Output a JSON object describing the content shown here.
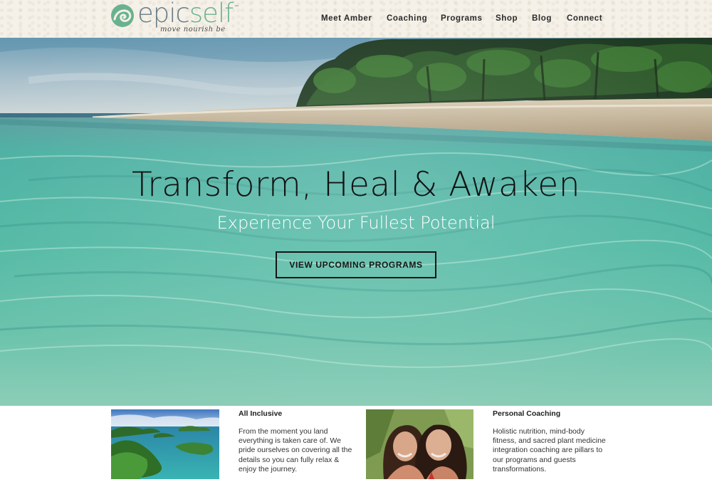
{
  "brand": {
    "logo_text_part1": "epic",
    "logo_text_part2": "self",
    "trademark": "™",
    "tagline": "move nourish be"
  },
  "nav": {
    "items": [
      {
        "label": "Meet Amber"
      },
      {
        "label": "Coaching"
      },
      {
        "label": "Programs"
      },
      {
        "label": "Shop"
      },
      {
        "label": "Blog"
      },
      {
        "label": "Connect"
      }
    ]
  },
  "hero": {
    "title": "Transform, Heal & Awaken",
    "subtitle": "Experience Your Fullest Potential",
    "cta_label": "VIEW UPCOMING PROGRAMS"
  },
  "features": [
    {
      "title": "All Inclusive",
      "text": "From the moment you land everything is taken care of. We pride ourselves on covering all the details so you can fully relax & enjoy the journey."
    },
    {
      "title": "Personal Coaching",
      "text": "Holistic nutrition, mind-body fitness, and sacred plant medicine integration coaching are pillars to our programs and guests transformations."
    }
  ],
  "colors": {
    "header_bg": "#f5f1e8",
    "logo_gray": "#6a7c86",
    "logo_green": "#6ab28f",
    "water_teal": "#4fb8a0",
    "text_dark": "#121212"
  },
  "icons": {
    "logo_mark": "spiral-wave-icon"
  }
}
